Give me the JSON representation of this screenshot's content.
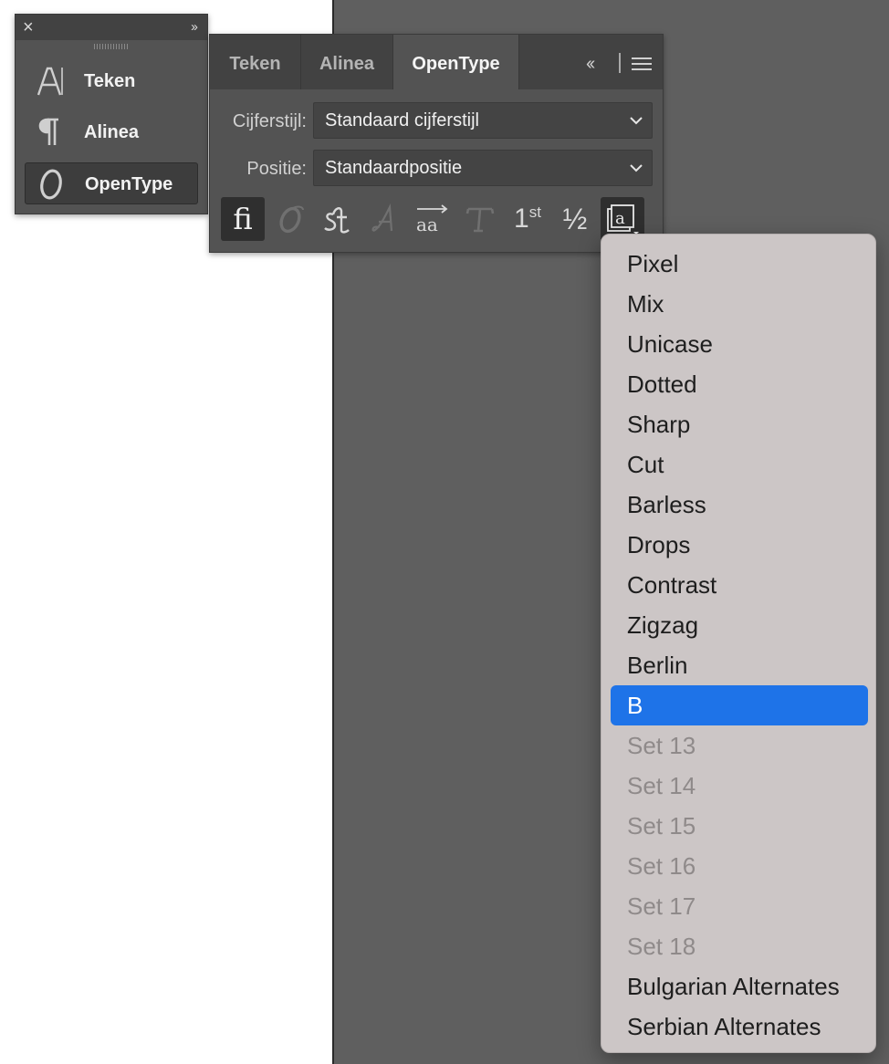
{
  "dock": {
    "items": [
      {
        "label": "Teken",
        "icon": "character-icon"
      },
      {
        "label": "Alinea",
        "icon": "paragraph-icon"
      },
      {
        "label": "OpenType",
        "icon": "opentype-icon"
      }
    ],
    "active_index": 2
  },
  "panel": {
    "tabs": [
      "Teken",
      "Alinea",
      "OpenType"
    ],
    "active_tab": "OpenType",
    "cijferstijl_label": "Cijferstijl:",
    "cijferstijl_value": "Standaard cijferstijl",
    "positie_label": "Positie:",
    "positie_value": "Standaardpositie",
    "opentype_buttons": [
      {
        "name": "standard-ligatures-icon",
        "glyph": "ﬁ",
        "active": true
      },
      {
        "name": "contextual-alternates-icon",
        "glyph": "𝒪",
        "active": false
      },
      {
        "name": "discretionary-ligatures-icon",
        "glyph": "st",
        "active": true
      },
      {
        "name": "swash-icon",
        "glyph": "𝒜",
        "active": false
      },
      {
        "name": "stylistic-alternates-icon",
        "glyph": "aa",
        "active": true
      },
      {
        "name": "titling-alternates-icon",
        "glyph": "T",
        "active": false
      },
      {
        "name": "ordinals-icon",
        "glyph": "1st",
        "active": true
      },
      {
        "name": "fractions-icon",
        "glyph": "½",
        "active": true
      },
      {
        "name": "stylistic-sets-icon",
        "glyph": "a",
        "active": true
      }
    ]
  },
  "menu": {
    "items": [
      {
        "label": "Pixel",
        "state": "normal"
      },
      {
        "label": "Mix",
        "state": "normal"
      },
      {
        "label": "Unicase",
        "state": "normal"
      },
      {
        "label": "Dotted",
        "state": "normal"
      },
      {
        "label": "Sharp",
        "state": "normal"
      },
      {
        "label": "Cut",
        "state": "normal"
      },
      {
        "label": "Barless",
        "state": "normal"
      },
      {
        "label": "Drops",
        "state": "normal"
      },
      {
        "label": "Contrast",
        "state": "normal"
      },
      {
        "label": "Zigzag",
        "state": "normal"
      },
      {
        "label": "Berlin",
        "state": "normal"
      },
      {
        "label": "B",
        "state": "selected"
      },
      {
        "label": "Set 13",
        "state": "disabled"
      },
      {
        "label": "Set 14",
        "state": "disabled"
      },
      {
        "label": "Set 15",
        "state": "disabled"
      },
      {
        "label": "Set 16",
        "state": "disabled"
      },
      {
        "label": "Set 17",
        "state": "disabled"
      },
      {
        "label": "Set 18",
        "state": "disabled"
      },
      {
        "label": "Bulgarian Alternates",
        "state": "normal"
      },
      {
        "label": "Serbian Alternates",
        "state": "normal"
      }
    ]
  },
  "colors": {
    "selected_bg": "#1e73e8",
    "panel_bg": "#535353",
    "tabbar_bg": "#424242",
    "menu_bg": "#ccc6c6"
  }
}
